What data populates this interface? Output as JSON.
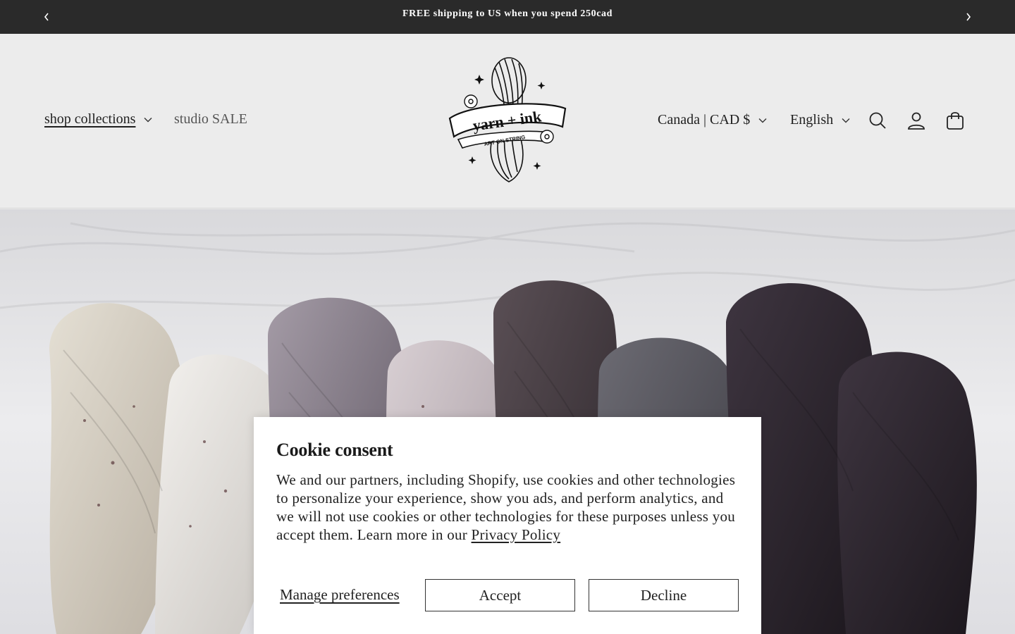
{
  "announcement": {
    "message": "FREE shipping to US when you spend 250cad"
  },
  "header": {
    "nav": {
      "collections_label": "shop collections",
      "sale_label": "studio SALE"
    },
    "logo": {
      "brand": "yarn + ink",
      "tagline": "ART ON STRING"
    },
    "country_selector": "Canada | CAD $",
    "language_selector": "English",
    "icons": [
      "search-icon",
      "account-icon",
      "cart-icon"
    ]
  },
  "cookie": {
    "title": "Cookie consent",
    "body": "We and our partners, including Shopify, use cookies and other technologies to personalize your experience, show you ads, and perform analytics, and we will not use cookies or other technologies for these purposes unless you accept them. Learn more in our ",
    "privacy_link": "Privacy Policy",
    "manage_label": "Manage preferences",
    "accept_label": "Accept",
    "decline_label": "Decline"
  },
  "colors": {
    "announcement_bg": "#2a2a2a",
    "header_bg": "#ececec",
    "text": "#1f1f1f"
  }
}
